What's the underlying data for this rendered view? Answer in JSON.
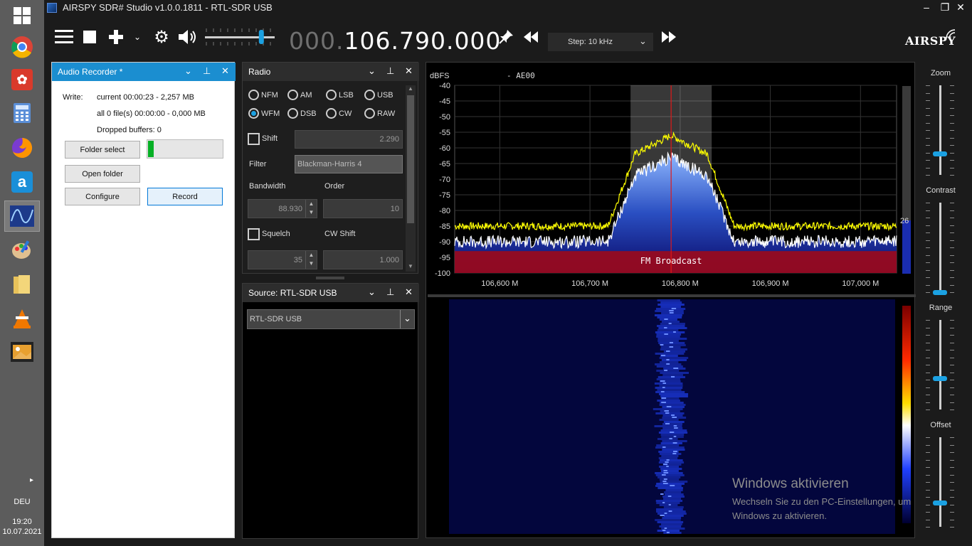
{
  "window": {
    "title": "AIRSPY SDR# Studio v1.0.0.1811 - RTL-SDR USB",
    "controls": [
      "minimize",
      "maximize",
      "close"
    ]
  },
  "taskbar": {
    "apps": [
      "windows-start",
      "chrome",
      "app-red",
      "calculator",
      "firefox",
      "amazon-a",
      "sdr-sharp",
      "paint",
      "file-explorer",
      "vlc",
      "photos"
    ],
    "language": "DEU",
    "time": "19:20",
    "date": "10.07.2021"
  },
  "toolbar": {
    "frequency_dim": "000.",
    "frequency_main": "106.790.000",
    "step_label": "Step: 10 kHz",
    "logo": "AIRSPY",
    "volume_level": 0.9
  },
  "audio_recorder": {
    "title": "Audio Recorder *",
    "write_label": "Write:",
    "current": "current 00:00:23 - 2,257 MB",
    "all_files": "all 0 file(s) 00:00:00 - 0,000 MB",
    "dropped": "Dropped buffers: 0",
    "folder_select": "Folder select",
    "open_folder": "Open folder",
    "configure": "Configure",
    "record": "Record",
    "level": 0.08
  },
  "radio": {
    "title": "Radio",
    "modes_row1": [
      "NFM",
      "AM",
      "LSB",
      "USB"
    ],
    "modes_row2": [
      "WFM",
      "DSB",
      "CW",
      "RAW"
    ],
    "selected_mode": "WFM",
    "shift_label": "Shift",
    "shift_value": "2.290",
    "filter_label": "Filter",
    "filter_value": "Blackman-Harris 4",
    "bandwidth_label": "Bandwidth",
    "bandwidth_value": "88.930",
    "order_label": "Order",
    "order_value": "10",
    "squelch_label": "Squelch",
    "squelch_value": "35",
    "cwshift_label": "CW Shift",
    "cwshift_value": "1.000"
  },
  "source": {
    "title": "Source: RTL-SDR USB",
    "device": "RTL-SDR USB"
  },
  "spectrum": {
    "unit": "dBFS",
    "marker": "- AE00",
    "band_label": "FM Broadcast",
    "y_ticks": [
      "-40",
      "-45",
      "-50",
      "-55",
      "-60",
      "-65",
      "-70",
      "-75",
      "-80",
      "-85",
      "-90",
      "-95",
      "-100"
    ],
    "x_ticks": [
      "106,600 M",
      "106,700 M",
      "106,800 M",
      "106,900 M",
      "107,000 M"
    ],
    "gain_value": "26"
  },
  "controls": {
    "zoom": "Zoom",
    "contrast": "Contrast",
    "range": "Range",
    "offset": "Offset",
    "zoom_level": 0.24,
    "contrast_level": 0.0,
    "range_level": 0.35,
    "offset_level": 0.27
  },
  "watermark": {
    "title": "Windows aktivieren",
    "line1": "Wechseln Sie zu den PC-Einstellungen, um",
    "line2": "Windows zu aktivieren."
  },
  "chart_data": {
    "type": "line",
    "xlabel": "",
    "ylabel": "dBFS",
    "ylim": [
      -100,
      -40
    ],
    "xlim": [
      106.55,
      107.04
    ],
    "grid": true,
    "center": 106.79,
    "filter_band": [
      106.745,
      106.835
    ],
    "series": [
      {
        "peak": -56,
        "floor": -85,
        "color": "#ffff00"
      },
      {
        "peak": -63,
        "floor": -90,
        "color": "#ffffff"
      }
    ]
  }
}
